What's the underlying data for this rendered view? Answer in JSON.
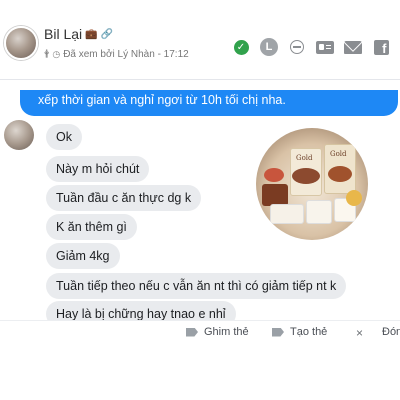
{
  "header": {
    "contact_name": "Bil Lại",
    "name_emoji": "💼",
    "name_link_icon": "🔗",
    "seen_text": "Đã xem bởi Lý Nhàn - 17:12",
    "actions": [
      "check-circle-icon",
      "label-l-icon",
      "block-icon",
      "contact-card-icon",
      "mail-icon",
      "facebook-icon"
    ],
    "action_l_label": "L",
    "action_fb_label": "f"
  },
  "chat": {
    "outgoing_message": "xếp thời gian và nghỉ ngơi từ 10h tối chị nha.",
    "incoming_messages": [
      "Ok",
      "Này m hỏi chút",
      "Tuần đầu c ăn thực dg k",
      "K ăn thêm gì",
      "Giảm 4kg",
      "Tuần tiếp theo nếu c vẫn ăn  nt thì có giảm tiếp nt k",
      "Hay là bị chững hay tnao e nhỉ"
    ],
    "product_label_1": "Gold",
    "product_label_2": "Gold"
  },
  "footer": {
    "pin_label": "Ghim thẻ",
    "create_label": "Tạo thẻ",
    "close_icon": "×",
    "last_label": "Đón"
  },
  "colors": {
    "accent_blue": "#1e88f5",
    "bubble_gray": "#e9ebee",
    "online_green": "#31a24c"
  }
}
